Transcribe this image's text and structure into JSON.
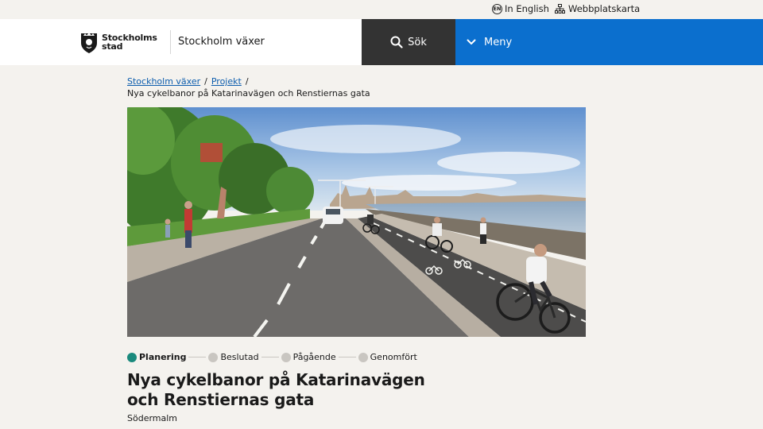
{
  "utility": {
    "lang_badge": "EN",
    "lang_label": "In English",
    "sitemap_label": "Webbplatskarta"
  },
  "header": {
    "logo_line1": "Stockholms",
    "logo_line2": "stad",
    "site_name": "Stockholm växer",
    "search_label": "Sök",
    "menu_label": "Meny",
    "menu_color": "#0b6fce",
    "search_color": "#333333"
  },
  "breadcrumb": {
    "items": [
      "Stockholm växer",
      "Projekt"
    ],
    "separator": "/",
    "current": "Nya cykelbanor på Katarinavägen och Renstiernas gata"
  },
  "steps": [
    {
      "label": "Planering",
      "active": true
    },
    {
      "label": "Beslutad",
      "active": false
    },
    {
      "label": "Pågående",
      "active": false
    },
    {
      "label": "Genomfört",
      "active": false
    }
  ],
  "active_step_color": "#1a8a7d",
  "page": {
    "title": "Nya cykelbanor på Katarinavägen och Renstiernas gata",
    "district": "Södermalm"
  },
  "hero": {
    "icon": "bicycle-lane-illustration"
  }
}
